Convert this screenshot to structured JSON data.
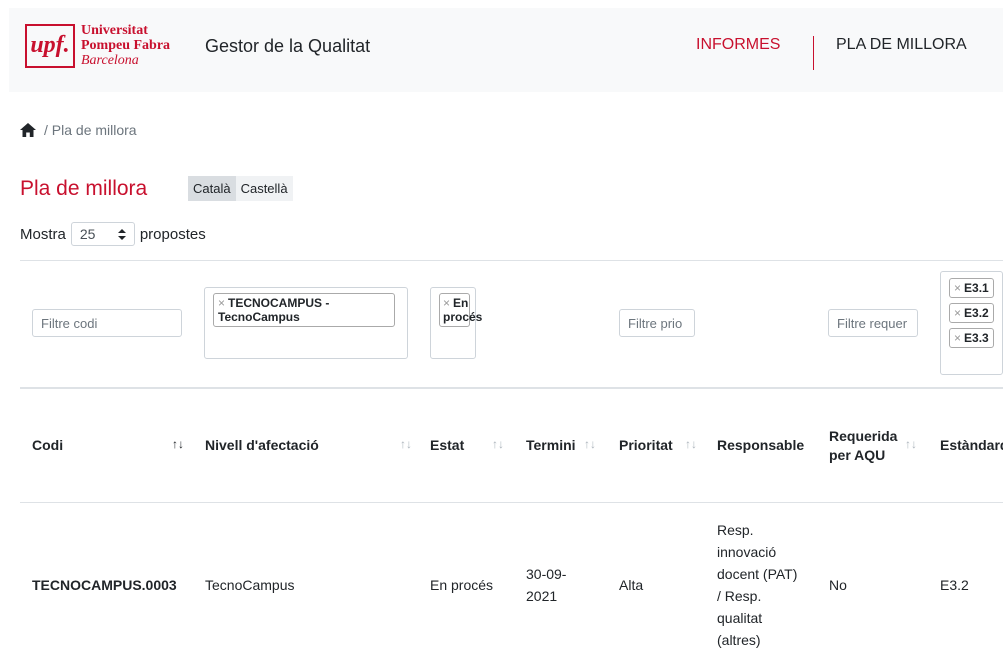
{
  "header": {
    "logo": {
      "mark": "upf.",
      "line1": "Universitat",
      "line2": "Pompeu Fabra",
      "line3": "Barcelona"
    },
    "app_title": "Gestor de la Qualitat",
    "nav": {
      "informes": "INFORMES",
      "pla": "PLA DE MILLORA"
    }
  },
  "breadcrumb": {
    "current": "Pla de millora"
  },
  "page": {
    "title": "Pla de millora",
    "languages": [
      "Català",
      "Castellà"
    ],
    "active_language": "Català"
  },
  "page_size": {
    "prefix": "Mostra",
    "value": "25",
    "suffix": "propostes"
  },
  "filters": {
    "codi_placeholder": "Filtre codi",
    "nivell_selected": "TECNOCAMPUS - TecnoCampus",
    "estat_selected": "En procés",
    "prioritat_placeholder": "Filtre prio",
    "requerida_placeholder": "Filtre requer",
    "estandard_selected": [
      "E3.1",
      "E3.2",
      "E3.3"
    ]
  },
  "table": {
    "columns": [
      "Codi",
      "Nivell d'afectació",
      "Estat",
      "Termini",
      "Prioritat",
      "Responsable",
      "Requerida per AQU",
      "Estàndard"
    ],
    "rows": [
      {
        "codi": "TECNOCAMPUS.0003",
        "nivell": "TecnoCampus",
        "estat": "En procés",
        "termini": "30-09-2021",
        "prioritat": "Alta",
        "responsable": "Resp. innovació docent (PAT) / Resp. qualitat (altres)",
        "requerida": "No",
        "estandard": "E3.2"
      }
    ]
  },
  "colors": {
    "brand": "#c8102e",
    "header_bg": "#f8f9fa"
  },
  "icons": {
    "home": "home-icon",
    "sort": "sort-arrows-icon",
    "chip_remove": "close-icon"
  }
}
